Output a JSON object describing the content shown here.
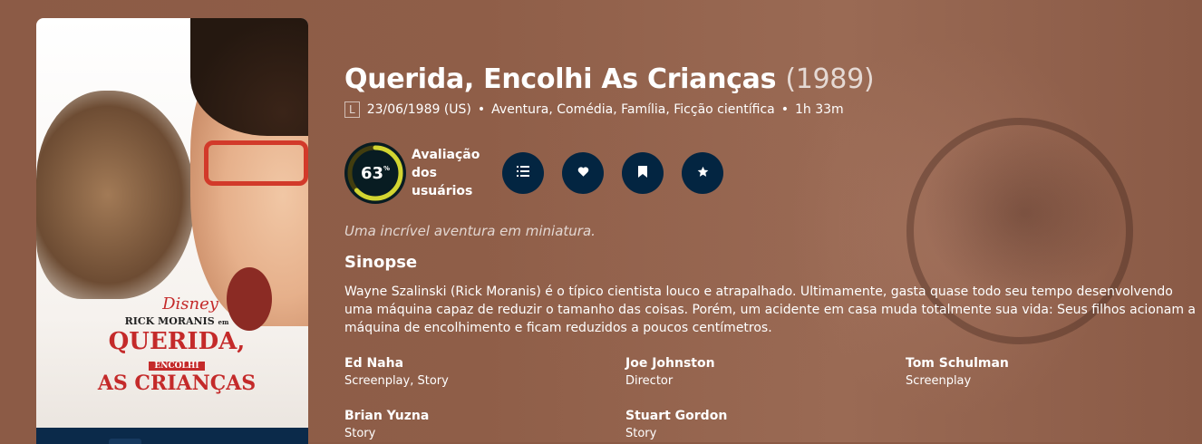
{
  "movie": {
    "title": "Querida, Encolhi As Crianças",
    "year": "(1989)",
    "certification": "L",
    "release": "23/06/1989 (US)",
    "genres": "Aventura, Comédia, Família, Ficção científica",
    "runtime": "1h 33m",
    "tagline": "Uma incrível aventura em miniatura.",
    "overview_heading": "Sinopse",
    "overview": "Wayne Szalinski (Rick Moranis) é o típico cientista louco e atrapalhado. Ultimamente, gasta quase todo seu tempo desenvolvendo uma máquina capaz de reduzir o tamanho das coisas. Porém, um acidente em casa muda totalmente sua vida: Seus filhos acionam a máquina de encolhimento e ficam reduzidos a poucos centímetros."
  },
  "score": {
    "value": "63",
    "unit": "%",
    "percent": 63,
    "label_line1": "Avaliação",
    "label_line2": "dos",
    "label_line3": "usuários",
    "ring_color": "#d2d531",
    "track_color": "#423d0f"
  },
  "actions": {
    "list_icon": "list-icon",
    "favorite_icon": "heart-icon",
    "watchlist_icon": "bookmark-icon",
    "rate_icon": "star-icon"
  },
  "poster": {
    "studio": "Disney",
    "actor": "RICK MORANIS",
    "actor_small": "em",
    "title_line1": "QUERIDA,",
    "title_line2": "ENCOLHI",
    "title_line3": "AS CRIANÇAS"
  },
  "crew": [
    {
      "name": "Ed Naha",
      "role": "Screenplay, Story"
    },
    {
      "name": "Joe Johnston",
      "role": "Director"
    },
    {
      "name": "Tom Schulman",
      "role": "Screenplay"
    },
    {
      "name": "Brian Yuzna",
      "role": "Story"
    },
    {
      "name": "Stuart Gordon",
      "role": "Story"
    }
  ],
  "colors": {
    "background": "#8b5a45",
    "button": "#032541"
  }
}
